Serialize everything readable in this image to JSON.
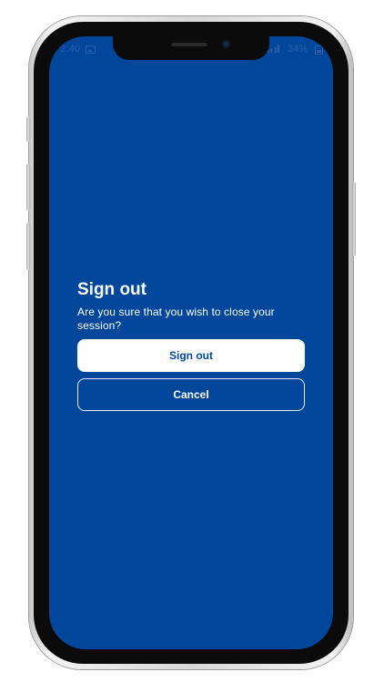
{
  "status_bar": {
    "time": "2:40",
    "battery": "34%",
    "icons": [
      "photo-icon",
      "signal-icon",
      "battery-icon"
    ]
  },
  "dialog": {
    "title": "Sign out",
    "message": "Are you sure that you wish to close your session?",
    "confirm_label": "Sign out",
    "cancel_label": "Cancel"
  },
  "colors": {
    "background": "#00479b",
    "primary_button_bg": "#ffffff",
    "primary_button_text": "#00479b",
    "text": "#ffffff"
  }
}
